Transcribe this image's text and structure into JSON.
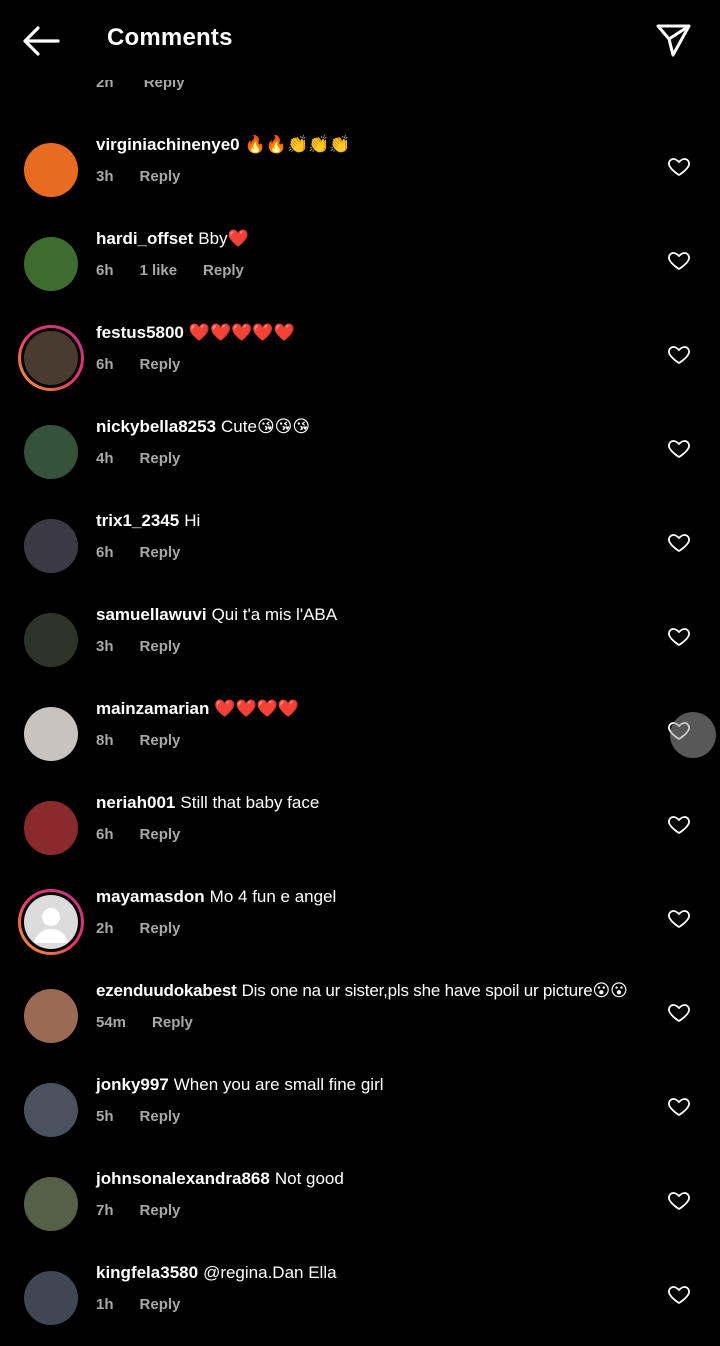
{
  "header": {
    "title": "Comments",
    "back_icon": "arrow-left-icon",
    "send_icon": "send-icon"
  },
  "colors": {
    "background": "#000000",
    "text": "#ffffff",
    "meta": "#a8a8a8",
    "heart_red": "#e0245e"
  },
  "partial_row": {
    "time": "2h",
    "reply": "Reply"
  },
  "comments": [
    {
      "user": "virginiachinenye0",
      "text": "🔥🔥👏👏👏",
      "time": "3h",
      "likes": "",
      "reply": "Reply",
      "ring": false,
      "avatar_color": "#e96b1f"
    },
    {
      "user": "hardi_offset",
      "text": "Bby❤️",
      "time": "6h",
      "likes": "1 like",
      "reply": "Reply",
      "ring": false,
      "avatar_color": "#3e6b2e"
    },
    {
      "user": "festus5800",
      "text": "❤️❤️❤️❤️❤️",
      "time": "6h",
      "likes": "",
      "reply": "Reply",
      "ring": true,
      "avatar_color": "#4a3b30"
    },
    {
      "user": "nickybella8253",
      "text": "Cute😘😘😘",
      "time": "4h",
      "likes": "",
      "reply": "Reply",
      "ring": false,
      "avatar_color": "#35533a"
    },
    {
      "user": "trix1_2345",
      "text": "Hi",
      "time": "6h",
      "likes": "",
      "reply": "Reply",
      "ring": false,
      "avatar_color": "#3b3a44"
    },
    {
      "user": "samuellawuvi",
      "text": "Qui t'a mis l'ABA",
      "time": "3h",
      "likes": "",
      "reply": "Reply",
      "ring": false,
      "avatar_color": "#2e3328"
    },
    {
      "user": "mainzamarian",
      "text": "❤️❤️❤️❤️",
      "time": "8h",
      "likes": "",
      "reply": "Reply",
      "ring": false,
      "avatar_color": "#c9c3c0"
    },
    {
      "user": "neriah001",
      "text": "Still that baby face",
      "time": "6h",
      "likes": "",
      "reply": "Reply",
      "ring": false,
      "avatar_color": "#8a2a2c"
    },
    {
      "user": "mayamasdon",
      "text": "Mo 4 fun e angel",
      "time": "2h",
      "likes": "",
      "reply": "Reply",
      "ring": true,
      "avatar_color": "#dcdcdc"
    },
    {
      "user": "ezenduudokabest",
      "text": "Dis one na ur sister,pls she have spoil ur picture😮😮",
      "time": "54m",
      "likes": "",
      "reply": "Reply",
      "ring": false,
      "avatar_color": "#9a6a55"
    },
    {
      "user": "jonky997",
      "text": "When you are small fine girl",
      "time": "5h",
      "likes": "",
      "reply": "Reply",
      "ring": false,
      "avatar_color": "#4a5260"
    },
    {
      "user": "johnsonalexandra868",
      "text": "Not good",
      "time": "7h",
      "likes": "",
      "reply": "Reply",
      "ring": false,
      "avatar_color": "#566048"
    },
    {
      "user": "kingfela3580",
      "text": "@regina.Dan Ella",
      "time": "1h",
      "likes": "",
      "reply": "Reply",
      "ring": false,
      "avatar_color": "#3f4654"
    }
  ]
}
